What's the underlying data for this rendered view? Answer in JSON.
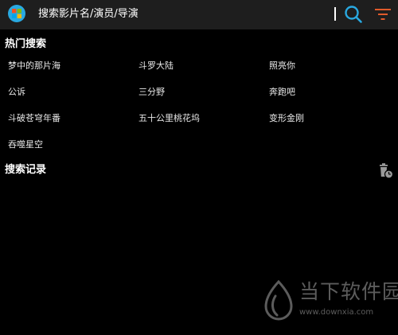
{
  "header": {
    "search_placeholder": "搜索影片名/演员/导演",
    "logo_icon": "app-logo-icon",
    "search_icon": "search-icon",
    "filter_icon": "filter-icon",
    "accent_color": "#29a9e1",
    "filter_color": "#e05a2b"
  },
  "hot_search": {
    "title": "热门搜索",
    "items": [
      "梦中的那片海",
      "斗罗大陆",
      "照亮你",
      "公诉",
      "三分野",
      "奔跑吧",
      "斗破苍穹年番",
      "五十公里桃花坞",
      "变形金刚",
      "吞噬星空"
    ]
  },
  "search_history": {
    "title": "搜索记录",
    "clear_icon": "clear-history-icon",
    "items": []
  },
  "watermark": {
    "name": "当下软件园",
    "url": "www.downxia.com"
  }
}
